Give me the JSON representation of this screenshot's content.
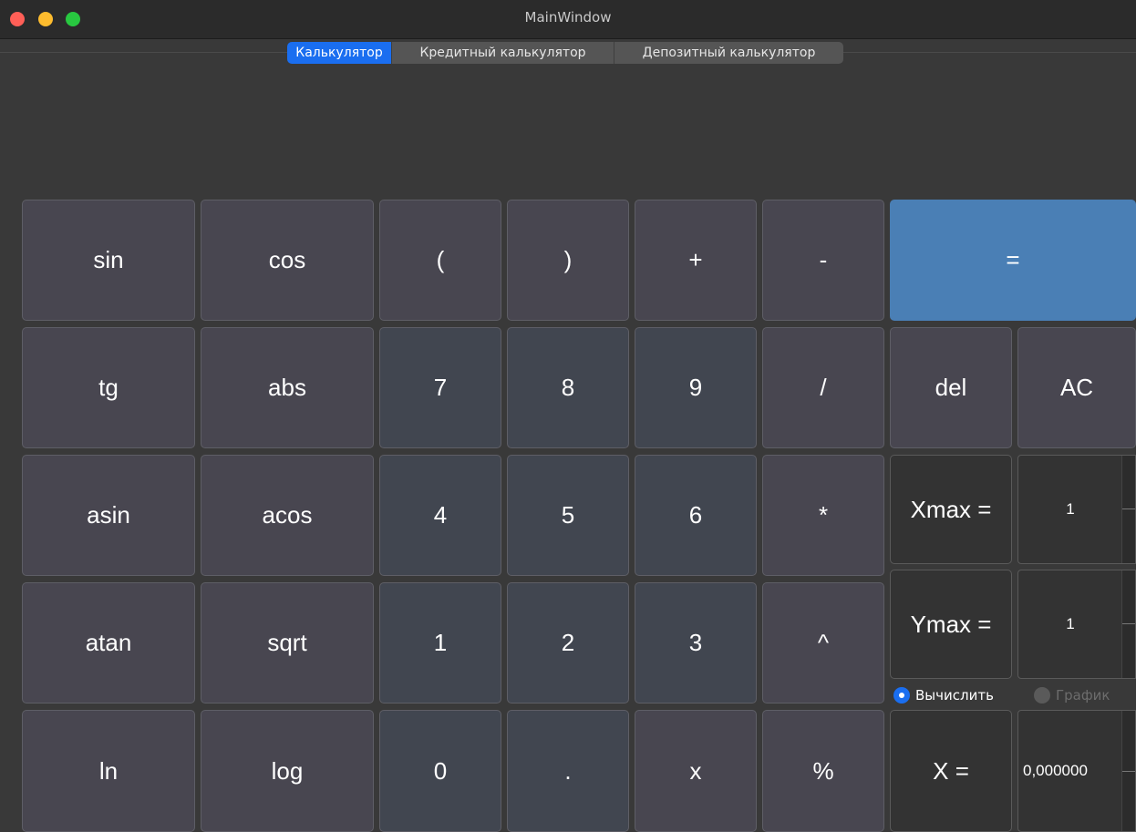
{
  "window": {
    "title": "MainWindow"
  },
  "tabs": [
    "Калькулятор",
    "Кредитный калькулятор",
    "Депозитный калькулятор"
  ],
  "keys": {
    "sin": "sin",
    "cos": "cos",
    "lparen": "(",
    "rparen": ")",
    "plus": "+",
    "minus": "-",
    "equals": "=",
    "tg": "tg",
    "abs": "abs",
    "n7": "7",
    "n8": "8",
    "n9": "9",
    "div": "/",
    "del": "del",
    "ac": "AC",
    "asin": "asin",
    "acos": "acos",
    "n4": "4",
    "n5": "5",
    "n6": "6",
    "mul": "*",
    "atan": "atan",
    "sqrt": "sqrt",
    "n1": "1",
    "n2": "2",
    "n3": "3",
    "pow": "^",
    "ln": "ln",
    "log": "log",
    "n0": "0",
    "dot": ".",
    "x": "x",
    "mod": "%"
  },
  "params": {
    "xmax_label": "Xmax =",
    "xmax_value": "1",
    "ymax_label": "Ymax =",
    "ymax_value": "1",
    "x_label": "X =",
    "x_value": "0,000000"
  },
  "mode": {
    "calc_label": "Вычислить",
    "graph_label": "График",
    "selected": "calc"
  }
}
